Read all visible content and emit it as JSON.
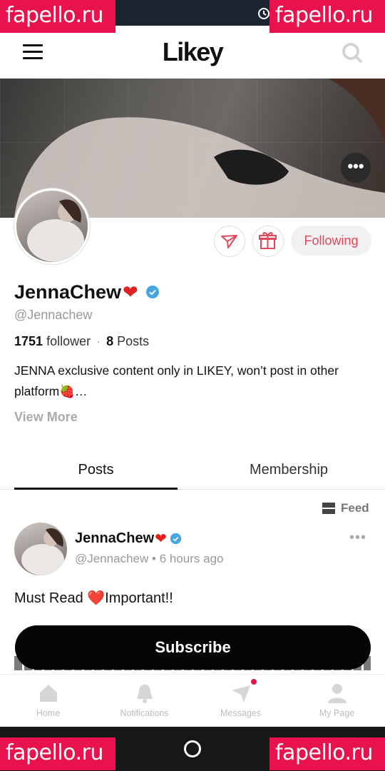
{
  "watermark": {
    "text": "fapello.ru",
    "color": "#e8134c"
  },
  "header": {
    "logo": "Likey"
  },
  "profile": {
    "name": "JennaChew",
    "name_emoji": "❤",
    "handle": "@Jennachew",
    "followers_count": "1751",
    "followers_label": "follower",
    "posts_count": "8",
    "posts_label": "Posts",
    "bio": "JENNA exclusive content only in LIKEY, won’t post in other platform🍓…",
    "view_more": "View More",
    "following_label": "Following",
    "accent_color": "#e2475c",
    "verified_color": "#46a6e0"
  },
  "tabs": [
    {
      "label": "Posts",
      "active": true
    },
    {
      "label": "Membership",
      "active": false
    }
  ],
  "feed": {
    "label": "Feed"
  },
  "post": {
    "author": "JennaChew",
    "author_emoji": "❤",
    "handle": "@Jennachew",
    "separator": "•",
    "time": "6 hours ago",
    "text": "Must Read ❤️Important!!"
  },
  "subscribe": {
    "label": "Subscribe"
  },
  "bottom_nav": [
    {
      "label": "Home",
      "icon": "home-icon"
    },
    {
      "label": "Notifications",
      "icon": "bell-icon"
    },
    {
      "label": "Messages",
      "icon": "paper-plane-icon"
    },
    {
      "label": "My Page",
      "icon": "person-icon"
    }
  ]
}
